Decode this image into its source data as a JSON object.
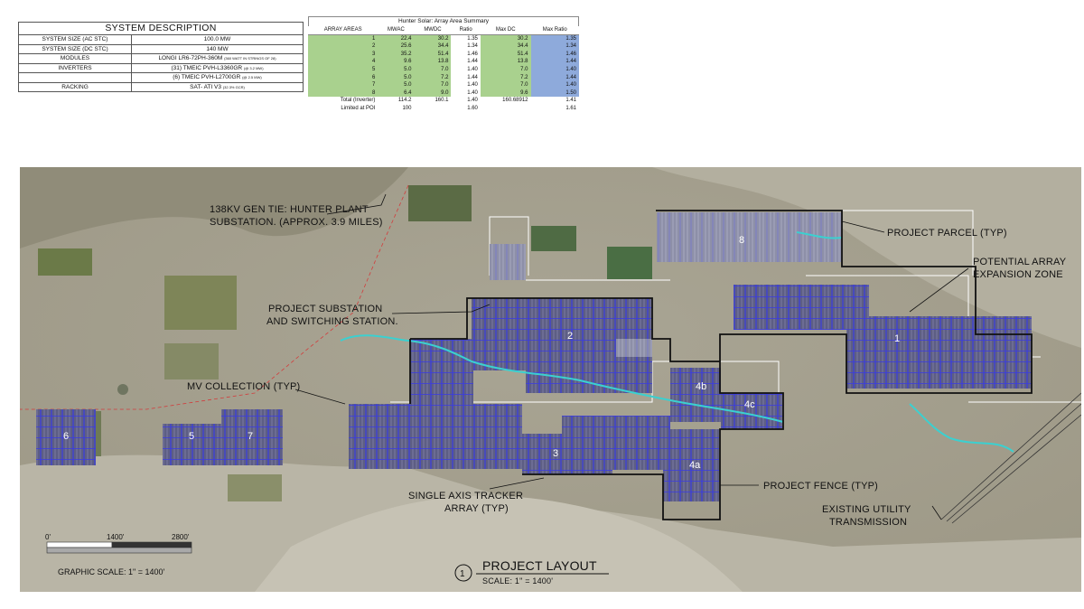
{
  "system_description": {
    "title": "SYSTEM DESCRIPTION",
    "rows": [
      {
        "label": "SYSTEM SIZE (AC STC)",
        "value": "100.0 MW",
        "note": ""
      },
      {
        "label": "SYSTEM SIZE (DC STC)",
        "value": "140 MW",
        "note": ""
      },
      {
        "label": "MODULES",
        "value": "LONGI LR6-72PH-360M",
        "note": "(360 WATT IN STRINGS OF 28)"
      },
      {
        "label": "INVERTERS",
        "value": "(31) TMEIC PVH-L3360GR",
        "note": "(@ 3.2 MW)"
      },
      {
        "label": "",
        "value": "(6) TMEIC PVH-L2700GR",
        "note": "(@ 2.5 MW)"
      },
      {
        "label": "RACKING",
        "value": "SAT- ATI V3",
        "note": "(32.3% GCR)"
      }
    ]
  },
  "array_summary": {
    "title": "Hunter Solar: Array Area Summary",
    "headers": [
      "ARRAY AREAS",
      "MWAC",
      "MWDC",
      "Ratio",
      "Max DC",
      "Max Ratio"
    ],
    "rows": [
      [
        "1",
        "22.4",
        "30.2",
        "1.35",
        "30.2",
        "1.35"
      ],
      [
        "2",
        "25.6",
        "34.4",
        "1.34",
        "34.4",
        "1.34"
      ],
      [
        "3",
        "35.2",
        "51.4",
        "1.46",
        "51.4",
        "1.46"
      ],
      [
        "4",
        "9.6",
        "13.8",
        "1.44",
        "13.8",
        "1.44"
      ],
      [
        "5",
        "5.0",
        "7.0",
        "1.40",
        "7.0",
        "1.40"
      ],
      [
        "6",
        "5.0",
        "7.2",
        "1.44",
        "7.2",
        "1.44"
      ],
      [
        "7",
        "5.0",
        "7.0",
        "1.40",
        "7.0",
        "1.40"
      ],
      [
        "8",
        "6.4",
        "9.0",
        "1.40",
        "9.6",
        "1.50"
      ]
    ],
    "total_row": [
      "Total (Inverter)",
      "114.2",
      "160.1",
      "1.40",
      "160.68912",
      "1.41"
    ],
    "poi_row": [
      "Limited at POI",
      "100",
      "",
      "1.60",
      "",
      "1.61"
    ]
  },
  "map": {
    "labels": {
      "gen_tie_1": "138KV GEN TIE: HUNTER PLANT",
      "gen_tie_2": "SUBSTATION. (APPROX. 3.9 MILES)",
      "substation_1": "PROJECT SUBSTATION",
      "substation_2": "AND SWITCHING STATION.",
      "mv_collection": "MV COLLECTION (TYP)",
      "tracker_1": "SINGLE AXIS TRACKER",
      "tracker_2": "ARRAY (TYP)",
      "fence": "PROJECT FENCE (TYP)",
      "parcel": "PROJECT PARCEL (TYP)",
      "expansion_1": "POTENTIAL ARRAY",
      "expansion_2": "EXPANSION ZONE",
      "transmission_1": "EXISTING UTILITY",
      "transmission_2": "TRANSMISSION"
    },
    "areas": [
      "1",
      "2",
      "3",
      "4a",
      "4b",
      "4c",
      "5",
      "6",
      "7",
      "8"
    ],
    "scale_bar": {
      "ticks": [
        "0'",
        "1400'",
        "2800'"
      ],
      "caption": "GRAPHIC SCALE:  1\" = 1400'"
    },
    "title_block": {
      "number": "1",
      "title": "PROJECT LAYOUT",
      "scale": "SCALE:  1\" = 1400'"
    }
  }
}
